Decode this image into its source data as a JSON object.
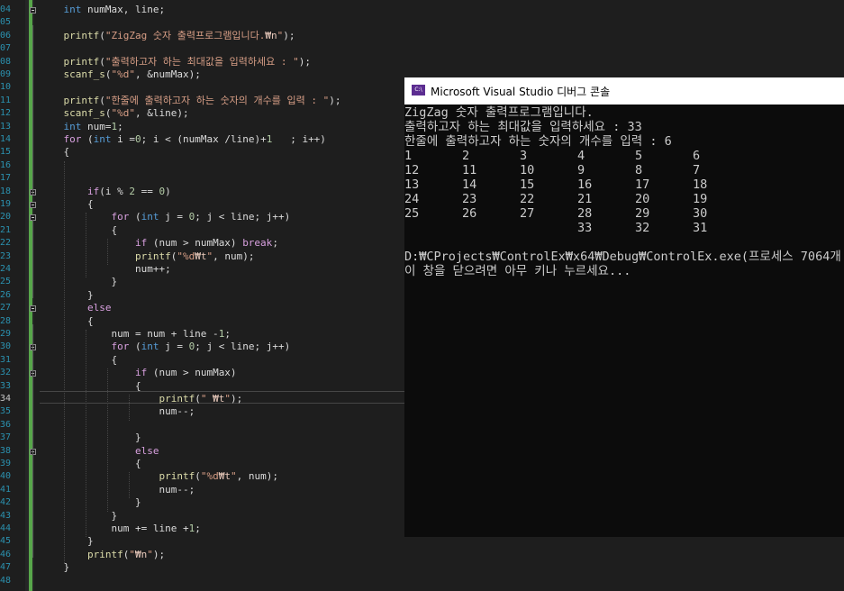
{
  "editor": {
    "line_numbers": [
      "04",
      "05",
      "06",
      "07",
      "08",
      "09",
      "10",
      "11",
      "12",
      "13",
      "14",
      "15",
      "16",
      "17",
      "18",
      "19",
      "20",
      "21",
      "22",
      "23",
      "24",
      "25",
      "26",
      "27",
      "28",
      "29",
      "30",
      "31",
      "32",
      "33",
      "34",
      "35",
      "36",
      "37",
      "38",
      "39",
      "40",
      "41",
      "42",
      "43",
      "44",
      "45",
      "46",
      "47",
      "48"
    ],
    "current_line": "34",
    "code_lines": [
      [
        {
          "t": "    "
        },
        {
          "t": "int",
          "c": "kw"
        },
        {
          "t": " numMax, line;"
        }
      ],
      [],
      [
        {
          "t": "    "
        },
        {
          "t": "printf",
          "c": "fn"
        },
        {
          "t": "("
        },
        {
          "t": "\"ZigZag 숫자 출력프로그램입니다.",
          "c": "str"
        },
        {
          "t": "₩n",
          "c": "esc"
        },
        {
          "t": "\"",
          "c": "str"
        },
        {
          "t": ");"
        }
      ],
      [],
      [
        {
          "t": "    "
        },
        {
          "t": "printf",
          "c": "fn"
        },
        {
          "t": "("
        },
        {
          "t": "\"출력하고자 하는 최대값을 입력하세요 : \"",
          "c": "str"
        },
        {
          "t": ");"
        }
      ],
      [
        {
          "t": "    "
        },
        {
          "t": "scanf_s",
          "c": "fn"
        },
        {
          "t": "("
        },
        {
          "t": "\"%d\"",
          "c": "str"
        },
        {
          "t": ", &numMax);"
        }
      ],
      [],
      [
        {
          "t": "    "
        },
        {
          "t": "printf",
          "c": "fn"
        },
        {
          "t": "("
        },
        {
          "t": "\"한줄에 출력하고자 하는 숫자의 개수를 입력 : \"",
          "c": "str"
        },
        {
          "t": ");"
        }
      ],
      [
        {
          "t": "    "
        },
        {
          "t": "scanf_s",
          "c": "fn"
        },
        {
          "t": "("
        },
        {
          "t": "\"%d\"",
          "c": "str"
        },
        {
          "t": ", &line);"
        }
      ],
      [
        {
          "t": "    "
        },
        {
          "t": "int",
          "c": "kw"
        },
        {
          "t": " num="
        },
        {
          "t": "1",
          "c": "num"
        },
        {
          "t": ";"
        }
      ],
      [
        {
          "t": "    "
        },
        {
          "t": "for",
          "c": "ctl"
        },
        {
          "t": " ("
        },
        {
          "t": "int",
          "c": "kw"
        },
        {
          "t": " i ="
        },
        {
          "t": "0",
          "c": "num"
        },
        {
          "t": "; i < (numMax /line)+"
        },
        {
          "t": "1",
          "c": "num"
        },
        {
          "t": "   ; i++)"
        }
      ],
      [
        {
          "t": "    {"
        }
      ],
      [],
      [],
      [
        {
          "t": "        "
        },
        {
          "t": "if",
          "c": "ctl"
        },
        {
          "t": "(i % "
        },
        {
          "t": "2",
          "c": "num"
        },
        {
          "t": " == "
        },
        {
          "t": "0",
          "c": "num"
        },
        {
          "t": ")"
        }
      ],
      [
        {
          "t": "        {"
        }
      ],
      [
        {
          "t": "            "
        },
        {
          "t": "for",
          "c": "ctl"
        },
        {
          "t": " ("
        },
        {
          "t": "int",
          "c": "kw"
        },
        {
          "t": " j = "
        },
        {
          "t": "0",
          "c": "num"
        },
        {
          "t": "; j < line; j++)"
        }
      ],
      [
        {
          "t": "            {"
        }
      ],
      [
        {
          "t": "                "
        },
        {
          "t": "if",
          "c": "ctl"
        },
        {
          "t": " (num > numMax) "
        },
        {
          "t": "break",
          "c": "ctl"
        },
        {
          "t": ";"
        }
      ],
      [
        {
          "t": "                "
        },
        {
          "t": "printf",
          "c": "fn"
        },
        {
          "t": "("
        },
        {
          "t": "\"%d",
          "c": "str"
        },
        {
          "t": "₩t",
          "c": "esc"
        },
        {
          "t": "\"",
          "c": "str"
        },
        {
          "t": ", num);"
        }
      ],
      [
        {
          "t": "                num++;"
        }
      ],
      [
        {
          "t": "            }"
        }
      ],
      [
        {
          "t": "        }"
        }
      ],
      [
        {
          "t": "        "
        },
        {
          "t": "else",
          "c": "ctl"
        }
      ],
      [
        {
          "t": "        {"
        }
      ],
      [
        {
          "t": "            num = num + line -"
        },
        {
          "t": "1",
          "c": "num"
        },
        {
          "t": ";"
        }
      ],
      [
        {
          "t": "            "
        },
        {
          "t": "for",
          "c": "ctl"
        },
        {
          "t": " ("
        },
        {
          "t": "int",
          "c": "kw"
        },
        {
          "t": " j = "
        },
        {
          "t": "0",
          "c": "num"
        },
        {
          "t": "; j < line; j++)"
        }
      ],
      [
        {
          "t": "            {"
        }
      ],
      [
        {
          "t": "                "
        },
        {
          "t": "if",
          "c": "ctl"
        },
        {
          "t": " (num > numMax)"
        }
      ],
      [
        {
          "t": "                {"
        }
      ],
      [
        {
          "t": "                    "
        },
        {
          "t": "printf",
          "c": "fn"
        },
        {
          "t": "("
        },
        {
          "t": "\" ",
          "c": "str"
        },
        {
          "t": "₩t",
          "c": "esc"
        },
        {
          "t": "\"",
          "c": "str"
        },
        {
          "t": ");"
        }
      ],
      [
        {
          "t": "                    num--;"
        }
      ],
      [],
      [
        {
          "t": "                }"
        }
      ],
      [
        {
          "t": "                "
        },
        {
          "t": "else",
          "c": "ctl"
        }
      ],
      [
        {
          "t": "                {"
        }
      ],
      [
        {
          "t": "                    "
        },
        {
          "t": "printf",
          "c": "fn"
        },
        {
          "t": "("
        },
        {
          "t": "\"%d",
          "c": "str"
        },
        {
          "t": "₩t",
          "c": "esc"
        },
        {
          "t": "\"",
          "c": "str"
        },
        {
          "t": ", num);"
        }
      ],
      [
        {
          "t": "                    num--;"
        }
      ],
      [
        {
          "t": "                }"
        }
      ],
      [
        {
          "t": "            }"
        }
      ],
      [
        {
          "t": "            num += line +"
        },
        {
          "t": "1",
          "c": "num"
        },
        {
          "t": ";"
        }
      ],
      [
        {
          "t": "        }"
        }
      ],
      [
        {
          "t": "        "
        },
        {
          "t": "printf",
          "c": "fn"
        },
        {
          "t": "("
        },
        {
          "t": "\"",
          "c": "str"
        },
        {
          "t": "₩n",
          "c": "esc"
        },
        {
          "t": "\"",
          "c": "str"
        },
        {
          "t": ");"
        }
      ],
      [
        {
          "t": "    }"
        }
      ],
      []
    ]
  },
  "console": {
    "icon_text": "C:\\",
    "title": "Microsoft Visual Studio 디버그 콘솔",
    "intro_lines": [
      "ZigZag 숫자 출력프로그램입니다.",
      "출력하고자 하는 최대값을 입력하세요 : 33",
      "한줄에 출력하고자 하는 숫자의 개수를 입력 : 6"
    ],
    "output_rows": [
      [
        "1",
        "2",
        "3",
        "4",
        "5",
        "6"
      ],
      [
        "12",
        "11",
        "10",
        "9",
        "8",
        "7"
      ],
      [
        "13",
        "14",
        "15",
        "16",
        "17",
        "18"
      ],
      [
        "24",
        "23",
        "22",
        "21",
        "20",
        "19"
      ],
      [
        "25",
        "26",
        "27",
        "28",
        "29",
        "30"
      ],
      [
        "",
        "",
        "",
        "33",
        "32",
        "31"
      ]
    ],
    "exit_lines": [
      "D:₩CProjects₩ControlEx₩x64₩Debug₩ControlEx.exe(프로세스 7064개",
      "이 창을 닫으려면 아무 키나 누르세요..."
    ]
  },
  "colors": {
    "editor_bg": "#1e1e1e",
    "line_number": "#2b91af",
    "change_bar": "#57a64a",
    "console_bg": "#0c0c0c",
    "console_text": "#cccccc"
  }
}
